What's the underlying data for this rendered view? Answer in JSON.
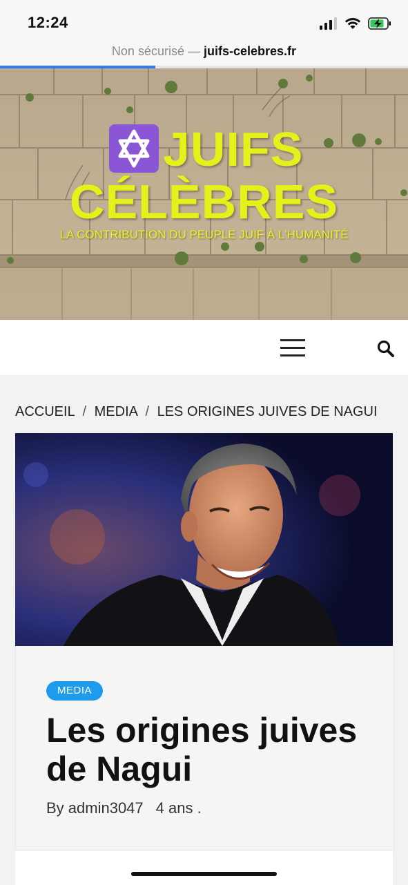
{
  "status_bar": {
    "time": "12:24"
  },
  "browser": {
    "security_label": "Non sécurisé —",
    "host": "juifs-celebres.fr",
    "load_progress": 0.38
  },
  "site": {
    "logo_line1": "JUIFS",
    "logo_line2": "CÉLÈBRES",
    "tagline": "LA CONTRIBUTION DU PEUPLE JUIF À L'HUMANITÉ",
    "accent_color": "#e6f01a",
    "logo_star_bg": "#8b56d6"
  },
  "nav": {
    "menu_icon": "hamburger-menu-icon",
    "search_icon": "search-icon"
  },
  "breadcrumb": {
    "items": [
      "ACCUEIL",
      "MEDIA",
      "LES ORIGINES JUIVES DE NAGUI"
    ],
    "separator": "/"
  },
  "post": {
    "category": "MEDIA",
    "category_color": "#1e9bec",
    "title": "Les origines juives de Nagui",
    "author": "By admin3047",
    "date": "4 ans ."
  }
}
